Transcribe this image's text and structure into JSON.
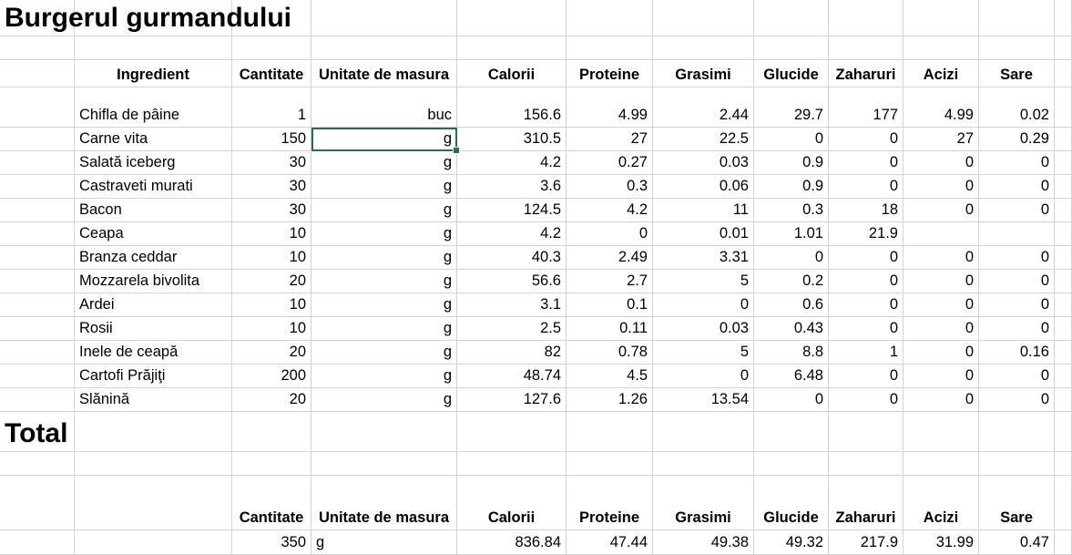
{
  "sheet": {
    "title": "Burgerul gurmandului",
    "total_title": "Total",
    "headers": [
      "Ingredient",
      "Cantitate",
      "Unitate de masura",
      "Calorii",
      "Proteine",
      "Grasimi",
      "Glucide",
      "Zaharuri",
      "Acizi",
      "Sare"
    ],
    "rows": [
      [
        "Chifla de pâine",
        "1",
        "buc",
        "156.6",
        "4.99",
        "2.44",
        "29.7",
        "177",
        "4.99",
        "0.02"
      ],
      [
        "Carne vita",
        "150",
        "g",
        "310.5",
        "27",
        "22.5",
        "0",
        "0",
        "27",
        "0.29"
      ],
      [
        "Salată iceberg",
        "30",
        "g",
        "4.2",
        "0.27",
        "0.03",
        "0.9",
        "0",
        "0",
        "0"
      ],
      [
        "Castraveti murati",
        "30",
        "g",
        "3.6",
        "0.3",
        "0.06",
        "0.9",
        "0",
        "0",
        "0"
      ],
      [
        "Bacon",
        "30",
        "g",
        "124.5",
        "4.2",
        "11",
        "0.3",
        "18",
        "0",
        "0"
      ],
      [
        "Ceapa",
        "10",
        "g",
        "4.2",
        "0",
        "0.01",
        "1.01",
        "21.9",
        "",
        ""
      ],
      [
        "Branza ceddar",
        "10",
        "g",
        "40.3",
        "2.49",
        "3.31",
        "0",
        "0",
        "0",
        "0"
      ],
      [
        "Mozzarela bivolita",
        "20",
        "g",
        "56.6",
        "2.7",
        "5",
        "0.2",
        "0",
        "0",
        "0"
      ],
      [
        "Ardei",
        "10",
        "g",
        "3.1",
        "0.1",
        "0",
        "0.6",
        "0",
        "0",
        "0"
      ],
      [
        "Rosii",
        "10",
        "g",
        "2.5",
        "0.11",
        "0.03",
        "0.43",
        "0",
        "0",
        "0"
      ],
      [
        "Inele de ceapă",
        "20",
        "g",
        "82",
        "0.78",
        "5",
        "8.8",
        "1",
        "0",
        "0.16"
      ],
      [
        "Cartofi Prăjiţi",
        "200",
        "g",
        "48.74",
        "4.5",
        "0",
        "6.48",
        "0",
        "0",
        "0"
      ],
      [
        "Slănină",
        "20",
        "g",
        "127.6",
        "1.26",
        "13.54",
        "0",
        "0",
        "0",
        "0"
      ]
    ],
    "total_headers": [
      "",
      "Cantitate",
      "Unitate de masura",
      "Calorii",
      "Proteine",
      "Grasimi",
      "Glucide",
      "Zaharuri",
      "Acizi",
      "Sare"
    ],
    "total_row": [
      "",
      "350",
      "g",
      "836.84",
      "47.44",
      "49.38",
      "49.32",
      "217.9",
      "31.99",
      "0.47"
    ],
    "selected_cell": "C4"
  }
}
